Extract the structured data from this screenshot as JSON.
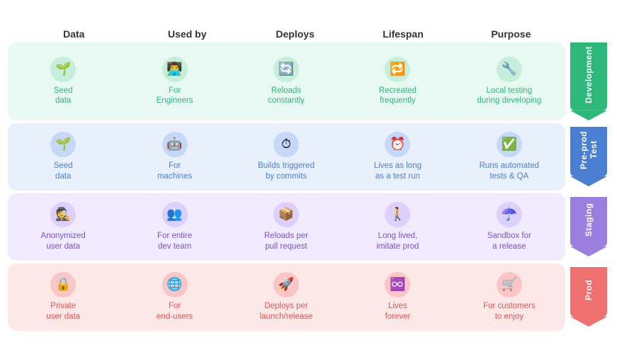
{
  "headers": [
    "Data",
    "Used by",
    "Deploys",
    "Lifespan",
    "Purpose"
  ],
  "sections": [
    {
      "id": "development",
      "label": "Development",
      "colorClass": "dev",
      "cells": [
        {
          "icon": "🌱",
          "label": "Seed\ndata"
        },
        {
          "icon": "👨‍💻",
          "label": "For\nEngineers"
        },
        {
          "icon": "🔄",
          "label": "Reloads\nconstantly"
        },
        {
          "icon": "🔁",
          "label": "Recreated\nfrequently"
        },
        {
          "icon": "🔧",
          "label": "Local testing\nduring developing"
        }
      ]
    },
    {
      "id": "test",
      "label": "Pre-prod\nTest",
      "colorClass": "test",
      "cells": [
        {
          "icon": "🌱",
          "label": "Seed\ndata"
        },
        {
          "icon": "🤖",
          "label": "For\nmachines"
        },
        {
          "icon": "⏱",
          "label": "Builds triggered\nby commits"
        },
        {
          "icon": "⏰",
          "label": "Lives as long\nas a test run"
        },
        {
          "icon": "✅",
          "label": "Runs automated\ntests & QA"
        }
      ]
    },
    {
      "id": "staging",
      "label": "Staging",
      "colorClass": "staging",
      "cells": [
        {
          "icon": "🕵️",
          "label": "Anonymized\nuser data"
        },
        {
          "icon": "👥",
          "label": "For entire\ndev team"
        },
        {
          "icon": "📦",
          "label": "Reloads per\npull request"
        },
        {
          "icon": "🚶",
          "label": "Long lived,\nimitate prod"
        },
        {
          "icon": "☂️",
          "label": "Sandbox for\na release"
        }
      ]
    },
    {
      "id": "prod",
      "label": "Prod",
      "colorClass": "prod",
      "cells": [
        {
          "icon": "🔒",
          "label": "Private\nuser data"
        },
        {
          "icon": "🌐",
          "label": "For\nend-users"
        },
        {
          "icon": "🚀",
          "label": "Deploys per\nlaunch/release"
        },
        {
          "icon": "♾️",
          "label": "Lives\nforever"
        },
        {
          "icon": "🛒",
          "label": "For customers\nto enjoy"
        }
      ]
    }
  ]
}
